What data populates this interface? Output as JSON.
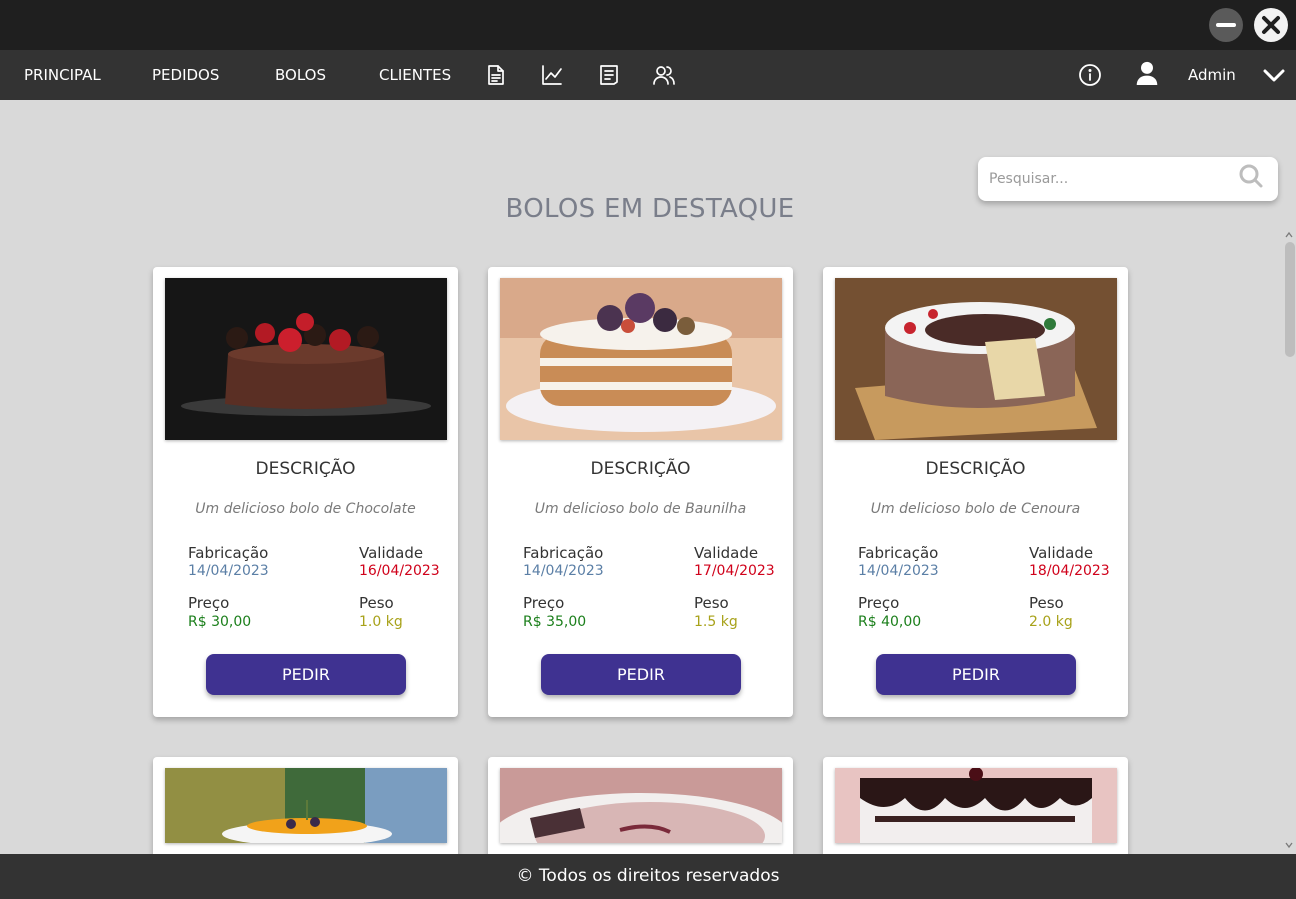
{
  "window": {
    "minimize_icon": "minimize-icon",
    "close_icon": "close-icon"
  },
  "nav": {
    "items": [
      {
        "label": "PRINCIPAL"
      },
      {
        "label": "PEDIDOS"
      },
      {
        "label": "BOLOS"
      },
      {
        "label": "CLIENTES"
      }
    ],
    "icons": [
      "document-icon",
      "chart-line-icon",
      "list-icon",
      "users-icon"
    ],
    "info_icon": "info-icon",
    "user_icon": "user-icon",
    "user_label": "Admin",
    "dropdown_icon": "chevron-down-icon"
  },
  "search": {
    "placeholder": "Pesquisar...",
    "value": ""
  },
  "page": {
    "title": "BOLOS EM DESTAQUE"
  },
  "cards": [
    {
      "desc_title": "DESCRIÇÃO",
      "description": "Um delicioso bolo de Chocolate",
      "fab_label": "Fabricação",
      "fab_date": "14/04/2023",
      "val_label": "Validade",
      "val_date": "16/04/2023",
      "price_label": "Preço",
      "price": "R$ 30,00",
      "weight_label": "Peso",
      "weight": "1.0 kg",
      "button": "PEDIR"
    },
    {
      "desc_title": "DESCRIÇÃO",
      "description": "Um delicioso bolo de Baunilha",
      "fab_label": "Fabricação",
      "fab_date": "14/04/2023",
      "val_label": "Validade",
      "val_date": "17/04/2023",
      "price_label": "Preço",
      "price": "R$ 35,00",
      "weight_label": "Peso",
      "weight": "1.5 kg",
      "button": "PEDIR"
    },
    {
      "desc_title": "DESCRIÇÃO",
      "description": "Um delicioso bolo de Cenoura",
      "fab_label": "Fabricação",
      "fab_date": "14/04/2023",
      "val_label": "Validade",
      "val_date": "18/04/2023",
      "price_label": "Preço",
      "price": "R$ 40,00",
      "weight_label": "Peso",
      "weight": "2.0 kg",
      "button": "PEDIR"
    }
  ],
  "footer": {
    "text": "© Todos os direitos reservados"
  },
  "colors": {
    "accent": "#3f3291",
    "fabrication_date": "#5b7fa6",
    "expiry_date": "#d0021b",
    "price": "#1b7f1b",
    "weight": "#a8a21a"
  }
}
